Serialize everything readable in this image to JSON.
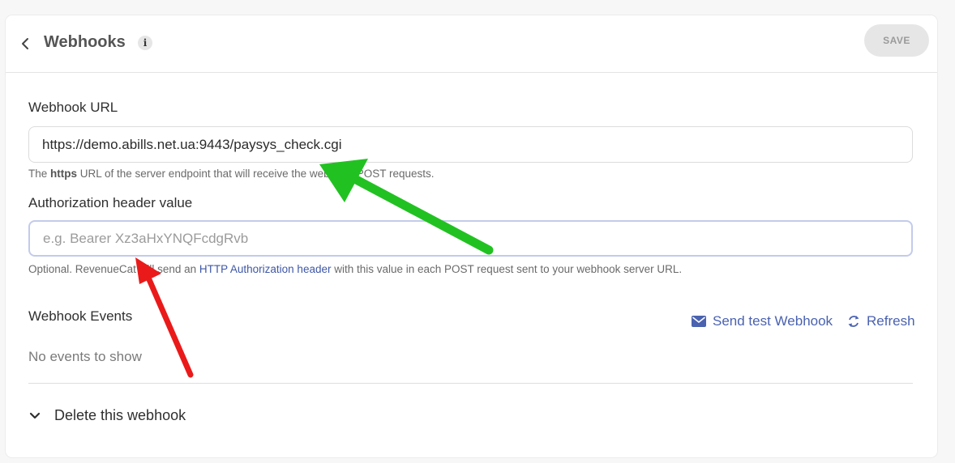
{
  "header": {
    "title": "Webhooks",
    "info_glyph": "i",
    "save_label": "SAVE"
  },
  "webhook_url": {
    "label": "Webhook URL",
    "value": "https://demo.abills.net.ua:9443/paysys_check.cgi",
    "help_prefix": "The ",
    "help_bold": "https",
    "help_suffix": " URL of the server endpoint that will receive the webhook POST requests."
  },
  "authorization": {
    "label": "Authorization header value",
    "placeholder": "e.g. Bearer Xz3aHxYNQFcdgRvb",
    "help_prefix": "Optional. RevenueCat will send an ",
    "help_link": "HTTP Authorization header",
    "help_suffix": " with this value in each POST request sent to your webhook server URL."
  },
  "events": {
    "label": "Webhook Events",
    "send_test_label": "Send test Webhook",
    "refresh_label": "Refresh",
    "empty_text": "No events to show"
  },
  "delete": {
    "label": "Delete this webhook"
  },
  "icons": {
    "back": "chevron-left-icon",
    "info": "info-icon",
    "send_test": "envelope-icon",
    "refresh": "refresh-icon",
    "delete_toggle": "chevron-down-icon"
  },
  "colors": {
    "accent": "#4a62b0",
    "annotation_green": "#22c122",
    "annotation_red": "#ea1a1a"
  }
}
